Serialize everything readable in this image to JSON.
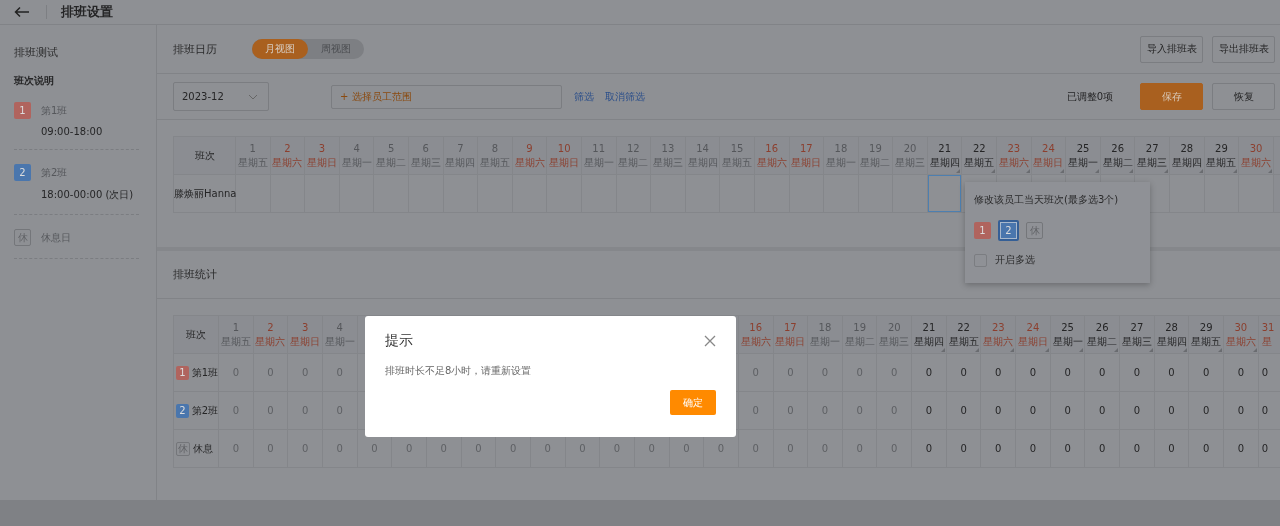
{
  "header": {
    "title": "排班设置"
  },
  "sidebar": {
    "title": "排班测试",
    "section": "班次说明",
    "shifts": [
      {
        "kind": "shift",
        "badge": "1",
        "color": "#b0645e",
        "name": "第1班",
        "time": "09:00-18:00"
      },
      {
        "kind": "shift",
        "badge": "2",
        "color": "#4a76ad",
        "name": "第2班",
        "time": "18:00-00:00 (次日)"
      },
      {
        "kind": "rest",
        "badge": "休",
        "name": "休息日"
      }
    ]
  },
  "calendar": {
    "title": "排班日历",
    "views": [
      {
        "label": "月视图",
        "selected": true
      },
      {
        "label": "周视图",
        "selected": false
      }
    ],
    "actions": [
      "导入排班表",
      "导出排班表"
    ],
    "month": "2023-12",
    "employee_field": {
      "placeholder": "+ 选择员工范围"
    },
    "links": [
      "筛选",
      "取消筛选"
    ],
    "adjusted": "已调整0项",
    "save": "保存",
    "restore": "恢复",
    "corner": "班次",
    "days": [
      {
        "day": "1",
        "weekday": "星期五",
        "weekend": false,
        "past": true
      },
      {
        "day": "2",
        "weekday": "星期六",
        "weekend": true,
        "past": true
      },
      {
        "day": "3",
        "weekday": "星期日",
        "weekend": true,
        "past": true
      },
      {
        "day": "4",
        "weekday": "星期一",
        "weekend": false,
        "past": true
      },
      {
        "day": "5",
        "weekday": "星期二",
        "weekend": false,
        "past": true
      },
      {
        "day": "6",
        "weekday": "星期三",
        "weekend": false,
        "past": true
      },
      {
        "day": "7",
        "weekday": "星期四",
        "weekend": false,
        "past": true
      },
      {
        "day": "8",
        "weekday": "星期五",
        "weekend": false,
        "past": true
      },
      {
        "day": "9",
        "weekday": "星期六",
        "weekend": true,
        "past": true
      },
      {
        "day": "10",
        "weekday": "星期日",
        "weekend": true,
        "past": true
      },
      {
        "day": "11",
        "weekday": "星期一",
        "weekend": false,
        "past": true
      },
      {
        "day": "12",
        "weekday": "星期二",
        "weekend": false,
        "past": true
      },
      {
        "day": "13",
        "weekday": "星期三",
        "weekend": false,
        "past": true
      },
      {
        "day": "14",
        "weekday": "星期四",
        "weekend": false,
        "past": true
      },
      {
        "day": "15",
        "weekday": "星期五",
        "weekend": false,
        "past": true
      },
      {
        "day": "16",
        "weekday": "星期六",
        "weekend": true,
        "past": true
      },
      {
        "day": "17",
        "weekday": "星期日",
        "weekend": true,
        "past": true
      },
      {
        "day": "18",
        "weekday": "星期一",
        "weekend": false,
        "past": true
      },
      {
        "day": "19",
        "weekday": "星期二",
        "weekend": false,
        "past": true
      },
      {
        "day": "20",
        "weekday": "星期三",
        "weekend": false,
        "past": true
      },
      {
        "day": "21",
        "weekday": "星期四",
        "weekend": false,
        "past": false
      },
      {
        "day": "22",
        "weekday": "星期五",
        "weekend": false,
        "past": false
      },
      {
        "day": "23",
        "weekday": "星期六",
        "weekend": true,
        "past": false
      },
      {
        "day": "24",
        "weekday": "星期日",
        "weekend": true,
        "past": false
      },
      {
        "day": "25",
        "weekday": "星期一",
        "weekend": false,
        "past": false
      },
      {
        "day": "26",
        "weekday": "星期二",
        "weekend": false,
        "past": false
      },
      {
        "day": "27",
        "weekday": "星期三",
        "weekend": false,
        "past": false
      },
      {
        "day": "28",
        "weekday": "星期四",
        "weekend": false,
        "past": false
      },
      {
        "day": "29",
        "weekday": "星期五",
        "weekend": false,
        "past": false
      },
      {
        "day": "30",
        "weekday": "星期六",
        "weekend": true,
        "past": false
      }
    ],
    "rows": [
      {
        "name": "滕焕丽Hanna",
        "cells": [
          {
            "kind": "slot",
            "selected": false
          },
          {
            "kind": "slot",
            "selected": false
          },
          {
            "kind": "slot",
            "selected": false
          },
          {
            "kind": "slot",
            "selected": false
          },
          {
            "kind": "slot",
            "selected": false
          },
          {
            "kind": "slot",
            "selected": false
          },
          {
            "kind": "slot",
            "selected": false
          },
          {
            "kind": "slot",
            "selected": false
          },
          {
            "kind": "slot",
            "selected": false
          },
          {
            "kind": "slot",
            "selected": false
          },
          {
            "kind": "slot",
            "selected": false
          },
          {
            "kind": "slot",
            "selected": false
          },
          {
            "kind": "slot",
            "selected": false
          },
          {
            "kind": "slot",
            "selected": false
          },
          {
            "kind": "slot",
            "selected": false
          },
          {
            "kind": "slot",
            "selected": false
          },
          {
            "kind": "slot",
            "selected": false
          },
          {
            "kind": "slot",
            "selected": false
          },
          {
            "kind": "slot",
            "selected": false
          },
          {
            "kind": "slot",
            "selected": false
          },
          {
            "kind": "slot",
            "selected": true
          },
          {
            "kind": "covered"
          },
          {
            "kind": "covered"
          },
          {
            "kind": "covered"
          },
          {
            "kind": "covered"
          },
          {
            "kind": "covered"
          },
          {
            "kind": "slot",
            "selected": false
          },
          {
            "kind": "slot",
            "selected": false
          },
          {
            "kind": "slot",
            "selected": false
          },
          {
            "kind": "slot",
            "selected": false
          }
        ]
      }
    ],
    "popover": {
      "title": "修改该员工当天班次(最多选3个)",
      "options": [
        {
          "kind": "shift",
          "label": "1",
          "color": "#b0645e",
          "selected": false
        },
        {
          "kind": "shift",
          "label": "2",
          "color": "#4a76ad",
          "selected": true
        },
        {
          "kind": "rest",
          "label": "休",
          "selected": false
        }
      ],
      "multi": {
        "label": "开启多选",
        "checked": false
      }
    }
  },
  "stats": {
    "title": "排班统计",
    "corner": "班次",
    "days": [
      {
        "kind": "day",
        "day": "1",
        "weekday": "星期五",
        "weekend": false,
        "past": true
      },
      {
        "kind": "day",
        "day": "2",
        "weekday": "星期六",
        "weekend": true,
        "past": true
      },
      {
        "kind": "day",
        "day": "3",
        "weekday": "星期日",
        "weekend": true,
        "past": true
      },
      {
        "kind": "day",
        "day": "4",
        "weekday": "星期一",
        "weekend": false,
        "past": true
      },
      {
        "kind": "covered",
        "past": true
      },
      {
        "kind": "covered",
        "past": true
      },
      {
        "kind": "covered",
        "past": true
      },
      {
        "kind": "covered",
        "past": true
      },
      {
        "kind": "covered",
        "past": true
      },
      {
        "kind": "covered",
        "past": true
      },
      {
        "kind": "covered",
        "past": true
      },
      {
        "kind": "covered",
        "past": true
      },
      {
        "kind": "covered",
        "past": true
      },
      {
        "kind": "covered",
        "past": true
      },
      {
        "kind": "covered",
        "past": true
      },
      {
        "kind": "day",
        "day": "16",
        "weekday": "星期六",
        "weekend": true,
        "past": true
      },
      {
        "kind": "day",
        "day": "17",
        "weekday": "星期日",
        "weekend": true,
        "past": true
      },
      {
        "kind": "day",
        "day": "18",
        "weekday": "星期一",
        "weekend": false,
        "past": true
      },
      {
        "kind": "day",
        "day": "19",
        "weekday": "星期二",
        "weekend": false,
        "past": true
      },
      {
        "kind": "day",
        "day": "20",
        "weekday": "星期三",
        "weekend": false,
        "past": true
      },
      {
        "kind": "day",
        "day": "21",
        "weekday": "星期四",
        "weekend": false,
        "past": false
      },
      {
        "kind": "day",
        "day": "22",
        "weekday": "星期五",
        "weekend": false,
        "past": false
      },
      {
        "kind": "day",
        "day": "23",
        "weekday": "星期六",
        "weekend": true,
        "past": false
      },
      {
        "kind": "day",
        "day": "24",
        "weekday": "星期日",
        "weekend": true,
        "past": false
      },
      {
        "kind": "day",
        "day": "25",
        "weekday": "星期一",
        "weekend": false,
        "past": false
      },
      {
        "kind": "day",
        "day": "26",
        "weekday": "星期二",
        "weekend": false,
        "past": false
      },
      {
        "kind": "day",
        "day": "27",
        "weekday": "星期三",
        "weekend": false,
        "past": false
      },
      {
        "kind": "day",
        "day": "28",
        "weekday": "星期四",
        "weekend": false,
        "past": false
      },
      {
        "kind": "day",
        "day": "29",
        "weekday": "星期五",
        "weekend": false,
        "past": false
      },
      {
        "kind": "day",
        "day": "30",
        "weekday": "星期六",
        "weekend": true,
        "past": false
      },
      {
        "kind": "day",
        "day": "31",
        "weekday": "星",
        "weekend": true,
        "past": false
      }
    ],
    "rows": [
      {
        "kind": "shift",
        "badge": "1",
        "color": "#b0645e",
        "name": "第1班",
        "cells": [
          {
            "kind": "value",
            "value": "0"
          },
          {
            "kind": "value",
            "value": "0"
          },
          {
            "kind": "value",
            "value": "0"
          },
          {
            "kind": "value",
            "value": "0"
          },
          {
            "kind": "covered"
          },
          {
            "kind": "covered"
          },
          {
            "kind": "covered"
          },
          {
            "kind": "covered"
          },
          {
            "kind": "covered"
          },
          {
            "kind": "covered"
          },
          {
            "kind": "covered"
          },
          {
            "kind": "covered"
          },
          {
            "kind": "covered"
          },
          {
            "kind": "covered"
          },
          {
            "kind": "covered"
          },
          {
            "kind": "value",
            "value": "0"
          },
          {
            "kind": "value",
            "value": "0"
          },
          {
            "kind": "value",
            "value": "0"
          },
          {
            "kind": "value",
            "value": "0"
          },
          {
            "kind": "value",
            "value": "0"
          },
          {
            "kind": "value",
            "value": "0"
          },
          {
            "kind": "value",
            "value": "0"
          },
          {
            "kind": "value",
            "value": "0"
          },
          {
            "kind": "value",
            "value": "0"
          },
          {
            "kind": "value",
            "value": "0"
          },
          {
            "kind": "value",
            "value": "0"
          },
          {
            "kind": "value",
            "value": "0"
          },
          {
            "kind": "value",
            "value": "0"
          },
          {
            "kind": "value",
            "value": "0"
          },
          {
            "kind": "value",
            "value": "0"
          },
          {
            "kind": "value",
            "value": "0"
          }
        ]
      },
      {
        "kind": "shift",
        "badge": "2",
        "color": "#4a76ad",
        "name": "第2班",
        "cells": [
          {
            "kind": "value",
            "value": "0"
          },
          {
            "kind": "value",
            "value": "0"
          },
          {
            "kind": "value",
            "value": "0"
          },
          {
            "kind": "value",
            "value": "0"
          },
          {
            "kind": "covered"
          },
          {
            "kind": "covered"
          },
          {
            "kind": "covered"
          },
          {
            "kind": "covered"
          },
          {
            "kind": "covered"
          },
          {
            "kind": "covered"
          },
          {
            "kind": "covered"
          },
          {
            "kind": "covered"
          },
          {
            "kind": "covered"
          },
          {
            "kind": "covered"
          },
          {
            "kind": "covered"
          },
          {
            "kind": "value",
            "value": "0"
          },
          {
            "kind": "value",
            "value": "0"
          },
          {
            "kind": "value",
            "value": "0"
          },
          {
            "kind": "value",
            "value": "0"
          },
          {
            "kind": "value",
            "value": "0"
          },
          {
            "kind": "value",
            "value": "0"
          },
          {
            "kind": "value",
            "value": "0"
          },
          {
            "kind": "value",
            "value": "0"
          },
          {
            "kind": "value",
            "value": "0"
          },
          {
            "kind": "value",
            "value": "0"
          },
          {
            "kind": "value",
            "value": "0"
          },
          {
            "kind": "value",
            "value": "0"
          },
          {
            "kind": "value",
            "value": "0"
          },
          {
            "kind": "value",
            "value": "0"
          },
          {
            "kind": "value",
            "value": "0"
          },
          {
            "kind": "value",
            "value": "0"
          }
        ]
      },
      {
        "kind": "rest",
        "badge": "休",
        "name": "休息",
        "cells": [
          {
            "kind": "value",
            "value": "0"
          },
          {
            "kind": "value",
            "value": "0"
          },
          {
            "kind": "value",
            "value": "0"
          },
          {
            "kind": "value",
            "value": "0"
          },
          {
            "kind": "value",
            "value": "0"
          },
          {
            "kind": "value",
            "value": "0"
          },
          {
            "kind": "value",
            "value": "0"
          },
          {
            "kind": "value",
            "value": "0"
          },
          {
            "kind": "value",
            "value": "0"
          },
          {
            "kind": "value",
            "value": "0"
          },
          {
            "kind": "value",
            "value": "0"
          },
          {
            "kind": "value",
            "value": "0"
          },
          {
            "kind": "value",
            "value": "0"
          },
          {
            "kind": "value",
            "value": "0"
          },
          {
            "kind": "value",
            "value": "0"
          },
          {
            "kind": "value",
            "value": "0"
          },
          {
            "kind": "value",
            "value": "0"
          },
          {
            "kind": "value",
            "value": "0"
          },
          {
            "kind": "value",
            "value": "0"
          },
          {
            "kind": "value",
            "value": "0"
          },
          {
            "kind": "value",
            "value": "0"
          },
          {
            "kind": "value",
            "value": "0"
          },
          {
            "kind": "value",
            "value": "0"
          },
          {
            "kind": "value",
            "value": "0"
          },
          {
            "kind": "value",
            "value": "0"
          },
          {
            "kind": "value",
            "value": "0"
          },
          {
            "kind": "value",
            "value": "0"
          },
          {
            "kind": "value",
            "value": "0"
          },
          {
            "kind": "value",
            "value": "0"
          },
          {
            "kind": "value",
            "value": "0"
          },
          {
            "kind": "value",
            "value": "0"
          }
        ]
      }
    ]
  },
  "dialog": {
    "title": "提示",
    "message": "排班时长不足8小时，请重新设置",
    "ok": "确定"
  }
}
